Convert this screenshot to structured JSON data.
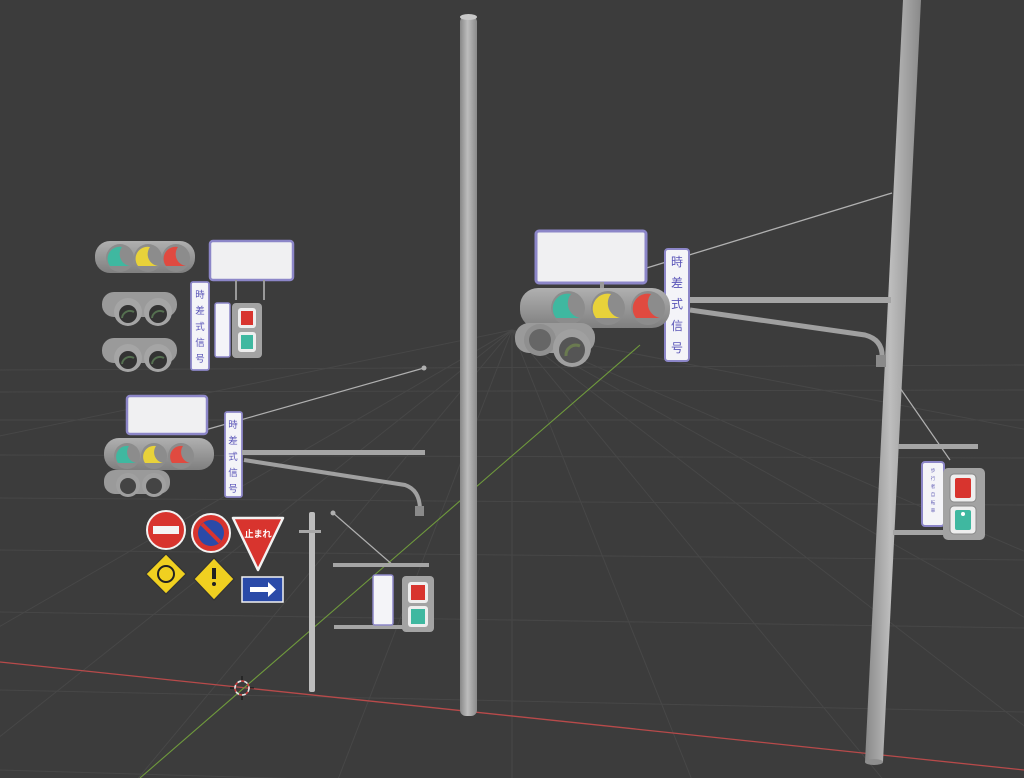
{
  "scene": {
    "background": "#3c3c3c",
    "grid_color": "#474747",
    "x_axis_color": "#b84a4a",
    "y_axis_color": "#6f9a3c"
  },
  "signs": {
    "time_diff_signal": [
      "時",
      "差",
      "式",
      "信",
      "号"
    ],
    "stop_label": "止まれ",
    "ped_plate_text": [
      "歩",
      "行",
      "者",
      "自",
      "転",
      "車",
      "専",
      "用"
    ]
  },
  "colors": {
    "pole": "#a8a8a8",
    "housing": "#9a9a9a",
    "lamp_green": "#3fb8a0",
    "lamp_yellow": "#e8d23a",
    "lamp_red": "#e04a40",
    "sign_red": "#d8342e",
    "sign_blue": "#2a4aa8",
    "sign_yellow": "#f0d020"
  },
  "icons": [
    "3d-cursor-icon",
    "arrow-right-icon",
    "pedestrian-icon"
  ]
}
